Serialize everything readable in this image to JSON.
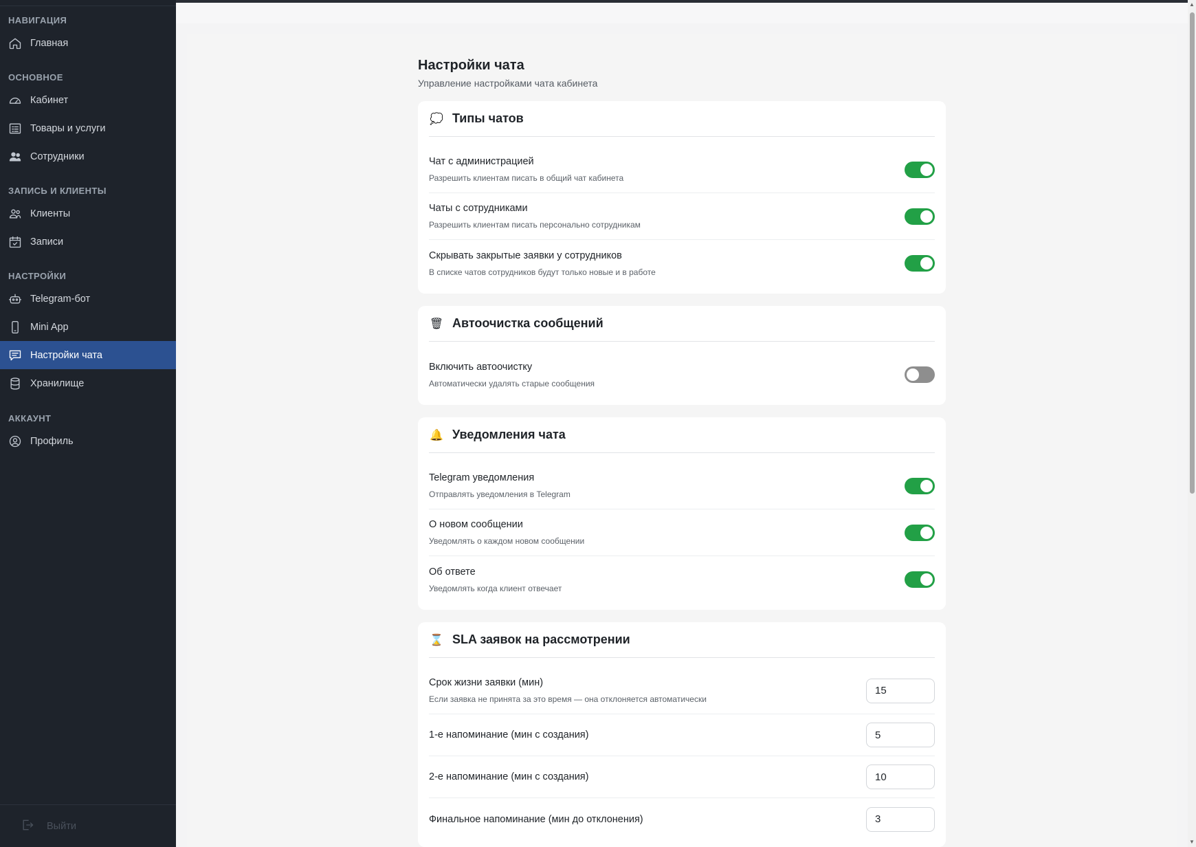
{
  "sidebar": {
    "sections": [
      {
        "title": "НАВИГАЦИЯ",
        "items": [
          {
            "label": "Главная",
            "icon": "home-icon"
          }
        ]
      },
      {
        "title": "ОСНОВНОЕ",
        "items": [
          {
            "label": "Кабинет",
            "icon": "dashboard-icon"
          },
          {
            "label": "Товары и услуги",
            "icon": "list-icon"
          },
          {
            "label": "Сотрудники",
            "icon": "users-icon"
          }
        ]
      },
      {
        "title": "ЗАПИСЬ И КЛИЕНТЫ",
        "items": [
          {
            "label": "Клиенты",
            "icon": "clients-icon"
          },
          {
            "label": "Записи",
            "icon": "calendar-check-icon"
          }
        ]
      },
      {
        "title": "НАСТРОЙКИ",
        "items": [
          {
            "label": "Telegram-бот",
            "icon": "robot-icon"
          },
          {
            "label": "Mini App",
            "icon": "phone-icon"
          },
          {
            "label": "Настройки чата",
            "icon": "chat-icon",
            "active": true
          },
          {
            "label": "Хранилище",
            "icon": "database-icon"
          }
        ]
      },
      {
        "title": "АККАУНТ",
        "items": [
          {
            "label": "Профиль",
            "icon": "profile-icon"
          }
        ]
      }
    ],
    "logout_label": "Выйти"
  },
  "page": {
    "title": "Настройки чата",
    "subtitle": "Управление настройками чата кабинета"
  },
  "cards": {
    "chat_types": {
      "emoji": "💭",
      "title": "Типы чатов",
      "rows": [
        {
          "label": "Чат с администрацией",
          "desc": "Разрешить клиентам писать в общий чат кабинета",
          "on": true
        },
        {
          "label": "Чаты с сотрудниками",
          "desc": "Разрешить клиентам писать персонально сотрудникам",
          "on": true
        },
        {
          "label": "Скрывать закрытые заявки у сотрудников",
          "desc": "В списке чатов сотрудников будут только новые и в работе",
          "on": true
        }
      ]
    },
    "autoclean": {
      "emoji": "🗑",
      "title": "Автоочистка сообщений",
      "rows": [
        {
          "label": "Включить автоочистку",
          "desc": "Автоматически удалять старые сообщения",
          "on": false
        }
      ]
    },
    "notifications": {
      "emoji": "🔔",
      "title": "Уведомления чата",
      "rows": [
        {
          "label": "Telegram уведомления",
          "desc": "Отправлять уведомления в Telegram",
          "on": true
        },
        {
          "label": "О новом сообщении",
          "desc": "Уведомлять о каждом новом сообщении",
          "on": true
        },
        {
          "label": "Об ответе",
          "desc": "Уведомлять когда клиент отвечает",
          "on": true
        }
      ]
    },
    "sla": {
      "emoji": "⌛",
      "title": "SLA заявок на рассмотрении",
      "rows": [
        {
          "label": "Срок жизни заявки (мин)",
          "desc": "Если заявка не принята за это время — она отклоняется автоматически",
          "value": "15"
        },
        {
          "label": "1-е напоминание (мин с создания)",
          "value": "5"
        },
        {
          "label": "2-е напоминание (мин с создания)",
          "value": "10"
        },
        {
          "label": "Финальное напоминание (мин до отклонения)",
          "value": "3"
        }
      ]
    }
  },
  "colors": {
    "sidebar_bg": "#1e232b",
    "active_item": "#2c5191",
    "toggle_on": "#22a046",
    "toggle_off": "#8e8e8e"
  }
}
